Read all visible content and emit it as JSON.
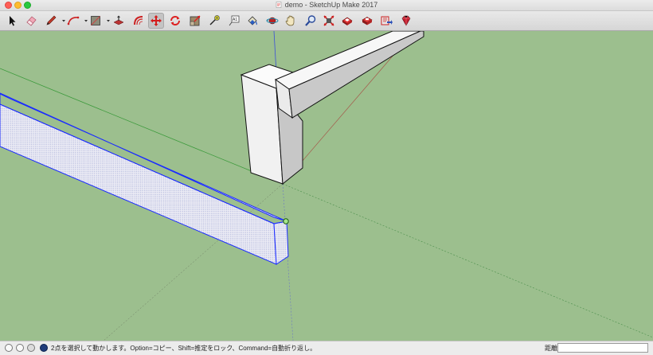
{
  "window": {
    "title": "demo - SketchUp Make 2017"
  },
  "toolbar": {
    "tools": [
      {
        "name": "select-tool",
        "icon": "arrow-icon"
      },
      {
        "name": "eraser-tool",
        "icon": "eraser-icon"
      },
      {
        "name": "line-tool",
        "icon": "pencil-icon"
      },
      {
        "name": "arc-tool",
        "icon": "arc-icon"
      },
      {
        "name": "shapes-tool",
        "icon": "rectangle-icon"
      },
      {
        "name": "push-pull-tool",
        "icon": "push-pull-icon"
      },
      {
        "name": "offset-tool",
        "icon": "offset-icon"
      },
      {
        "name": "move-tool",
        "icon": "move-icon",
        "active": true
      },
      {
        "name": "rotate-tool",
        "icon": "rotate-icon"
      },
      {
        "name": "scale-tool",
        "icon": "scale-icon"
      },
      {
        "name": "tape-measure-tool",
        "icon": "tape-measure-icon"
      },
      {
        "name": "text-tool",
        "icon": "text-icon"
      },
      {
        "name": "paint-bucket-tool",
        "icon": "paint-bucket-icon"
      },
      {
        "name": "orbit-tool",
        "icon": "orbit-icon"
      },
      {
        "name": "pan-tool",
        "icon": "hand-icon"
      },
      {
        "name": "zoom-tool",
        "icon": "magnifier-icon"
      },
      {
        "name": "zoom-extents-tool",
        "icon": "zoom-extents-icon"
      },
      {
        "name": "warehouse-tool",
        "icon": "warehouse-icon"
      },
      {
        "name": "share-model-tool",
        "icon": "share-icon"
      },
      {
        "name": "extension-warehouse-tool",
        "icon": "extension-warehouse-icon"
      },
      {
        "name": "ruby-tool",
        "icon": "ruby-icon"
      }
    ]
  },
  "status": {
    "message": "2点を選択して動かします。Option=コピー、Shift=推定をロック、Command=自動折り返し。",
    "measurements_label": "距離",
    "measurements_value": ""
  },
  "colors": {
    "viewport_bg": "#9cbf8e",
    "selection": "#1a2bff",
    "axis_blue": "#3b4fd8",
    "axis_green": "#3b9a3b",
    "axis_red": "#b2614a"
  }
}
